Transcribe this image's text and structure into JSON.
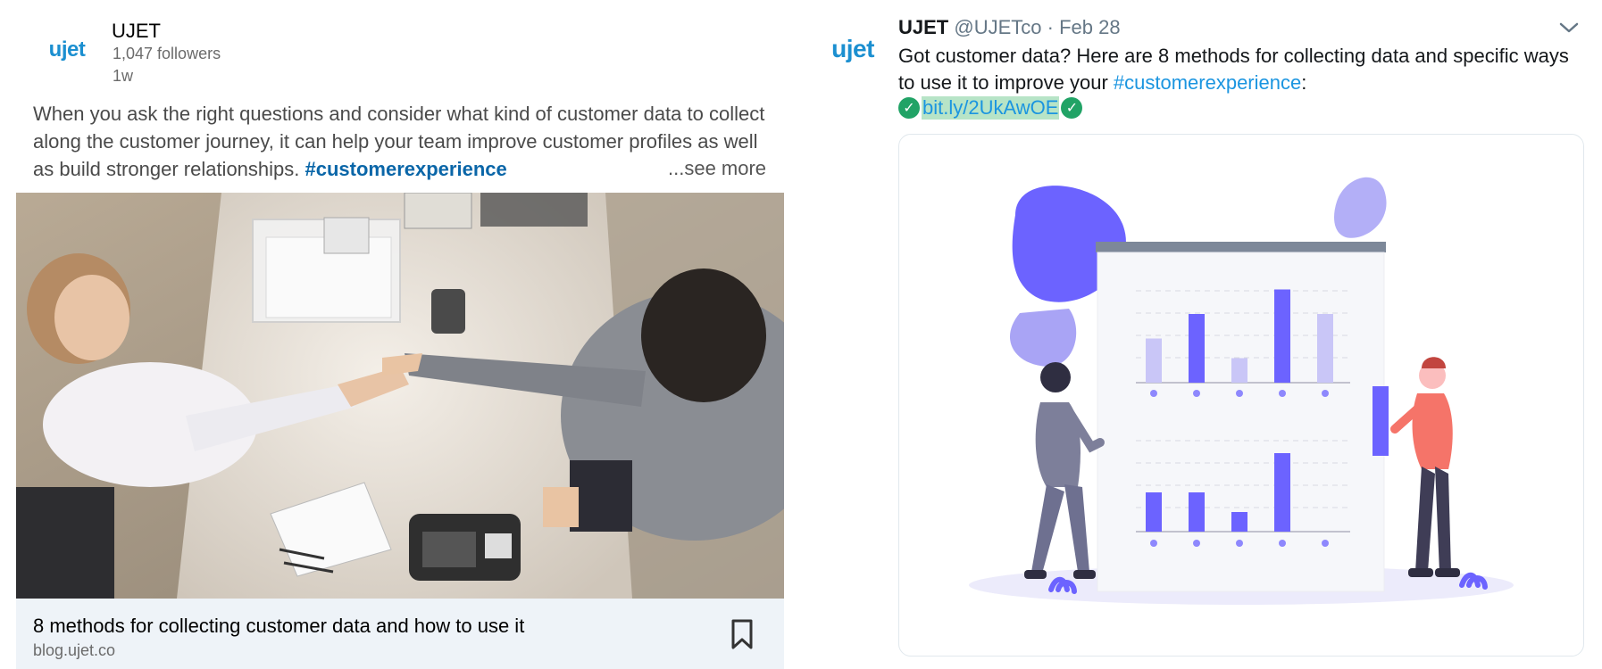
{
  "linkedin": {
    "logo_text": "ujet",
    "company_name": "UJET",
    "followers": "1,047 followers",
    "time_ago": "1w",
    "body_text": "When you ask the right questions and consider what kind of customer data to collect along the customer journey, it can help your team improve customer profiles as well as build stronger relationships. ",
    "hashtag": "#customerexperience",
    "see_more": "...see more",
    "image_icon": "handshake-photo",
    "card_title": "8 methods for collecting customer data and how to use it",
    "card_domain": "blog.ujet.co",
    "bookmark_icon": "bookmark-icon"
  },
  "twitter": {
    "logo_text": "ujet",
    "name": "UJET",
    "handle": "@UJETco",
    "separator": " · ",
    "date": "Feb 28",
    "text_main": "Got customer data? Here are 8 methods for collecting data and specific ways to use it to improve your ",
    "hashtag": "#customerexperience",
    "text_after": ":",
    "check_glyph": "✓",
    "link": "bit.ly/2UkAwOE",
    "chevron_icon": "chevron-down-icon",
    "card_image_icon": "data-chart-illustration",
    "colors": {
      "accent": "#6c63ff",
      "light_bar": "#c9c6f7",
      "link": "#1b95e0",
      "linkedin_hashtag": "#0a66a8"
    }
  },
  "illustration": {
    "top_chart_bars": [
      0.45,
      0.7,
      0.25,
      0.95,
      0.7
    ],
    "top_chart_light": [
      true,
      false,
      true,
      false,
      true
    ],
    "bottom_chart_bars": [
      0.4,
      0.4,
      0.2,
      0.8,
      0.0
    ]
  }
}
